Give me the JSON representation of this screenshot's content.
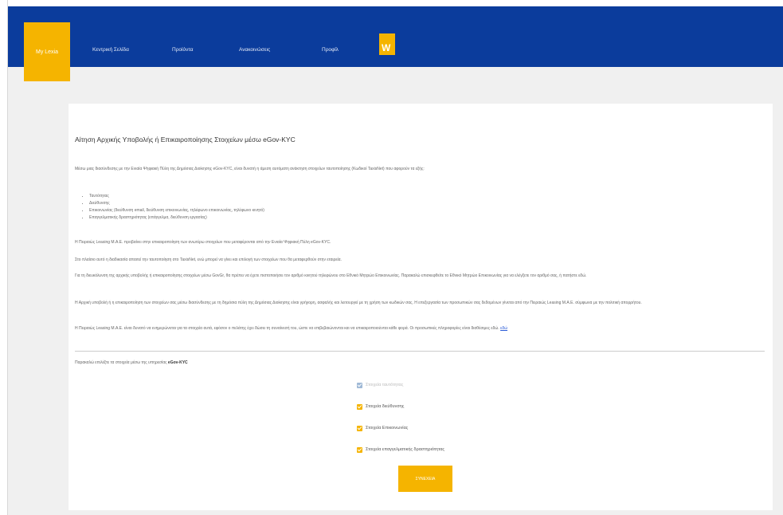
{
  "nav": {
    "active_label": "My Lexia",
    "items": [
      "Κεντρική Σελίδα",
      "Προϊόντα",
      "Ανακοινώσεις",
      "Προφίλ"
    ],
    "logo_letter": "W"
  },
  "page": {
    "title": "Αίτηση Αρχικής Υποβολής ή Επικαιροποίησης Στοιχείων μέσω eGov-KYC",
    "intro": "Μέσω μιας διασύνδεσης με την Ενιαία Ψηφιακή Πύλη της Δημόσιας Διοίκησης eGov-KYC, είναι δυνατή η άμεση αυτόματη ανάκτηση στοιχείων ταυτοποίησης (Κωδικοί TaxisNet) που αφορούν τα εξής:",
    "bullets": [
      "Ταυτότητας",
      "Διεύθυνσης",
      "Επικοινωνίας (διεύθυνση email, διεύθυνση επικοινωνίας, τηλέφωνο επικοινωνίας, τηλέφωνο κινητό)",
      "Επαγγελματικής δραστηριότητας (επάγγελμα, διεύθυνση εργασίας)"
    ],
    "paragraphs": [
      "Η Πειραιώς Leasing Μ.Α.Ε. προβαίνει στην επικαιροποίηση των ανωτέρω στοιχείων που μεταφέρονται από την Ενιαία Ψηφιακή Πύλη eGov-KYC.",
      "Στο πλαίσιο αυτό η διαδικασία απαιτεί την ταυτοποίηση στο TaxisNet, ενώ μπορεί να γίνει και επιλογή των στοιχείων που θα μεταφερθούν στην εταιρεία.",
      "Για τη διευκόλυνση της αρχικής υποβολής ή επικαιροποίησης στοιχείων μέσω GovGr, θα πρέπει να έχετε πιστοποιήσει τον αριθμό κινητού τηλεφώνου στο Εθνικό Μητρώο Επικοινωνίας. Παρακαλώ επισκεφθείτε το Εθνικό Μητρώο Επικοινωνίας για να ελέγξετε τον αριθμό σας, ή πατήστε εδώ.",
      "Η Αρχική υποβολή ή η επικαιροποίηση των στοιχείων σας μέσω διασύνδεσης με τη δημόσια πύλη της Δημόσιας Διοίκησης είναι γρήγορη, ασφαλής και λειτουργεί με τη χρήση των κωδικών σας. Η επεξεργασία των προσωπικών σας δεδομένων γίνεται από την Πειραιώς Leasing Μ.Α.Ε. σύμφωνα με την πολιτική απορρήτου.",
      "Η Πειραιώς Leasing Μ.Α.Ε. είναι δυνατό να ενημερώνεται για τα στοιχεία αυτά, εφόσον ο πελάτης έχει δώσει τη συναίνεσή του, ώστε να επιβεβαιώνονται και να επικαιροποιούνται κάθε φορά. Οι προσωπικές πληροφορίες είναι διαθέσιμες εδώ."
    ],
    "link_text": "εδώ",
    "choose_text": "Παρακαλώ επιλέξτε τα στοιχεία μέσω της υπηρεσίας",
    "choose_bold": "eGov-KYC",
    "options": [
      {
        "label": "Στοιχεία ταυτότητας",
        "disabled": true
      },
      {
        "label": "Στοιχεία διεύθυνσης",
        "disabled": false
      },
      {
        "label": "Στοιχεία Επικοινωνίας",
        "disabled": false
      },
      {
        "label": "Στοιχεία επαγγελματικής δραστηριότητας",
        "disabled": false
      }
    ],
    "continue_label": "ΣΥΝΕΧΕΙΑ"
  },
  "colors": {
    "navbar": "#0b3c9c",
    "accent": "#f5b400"
  }
}
